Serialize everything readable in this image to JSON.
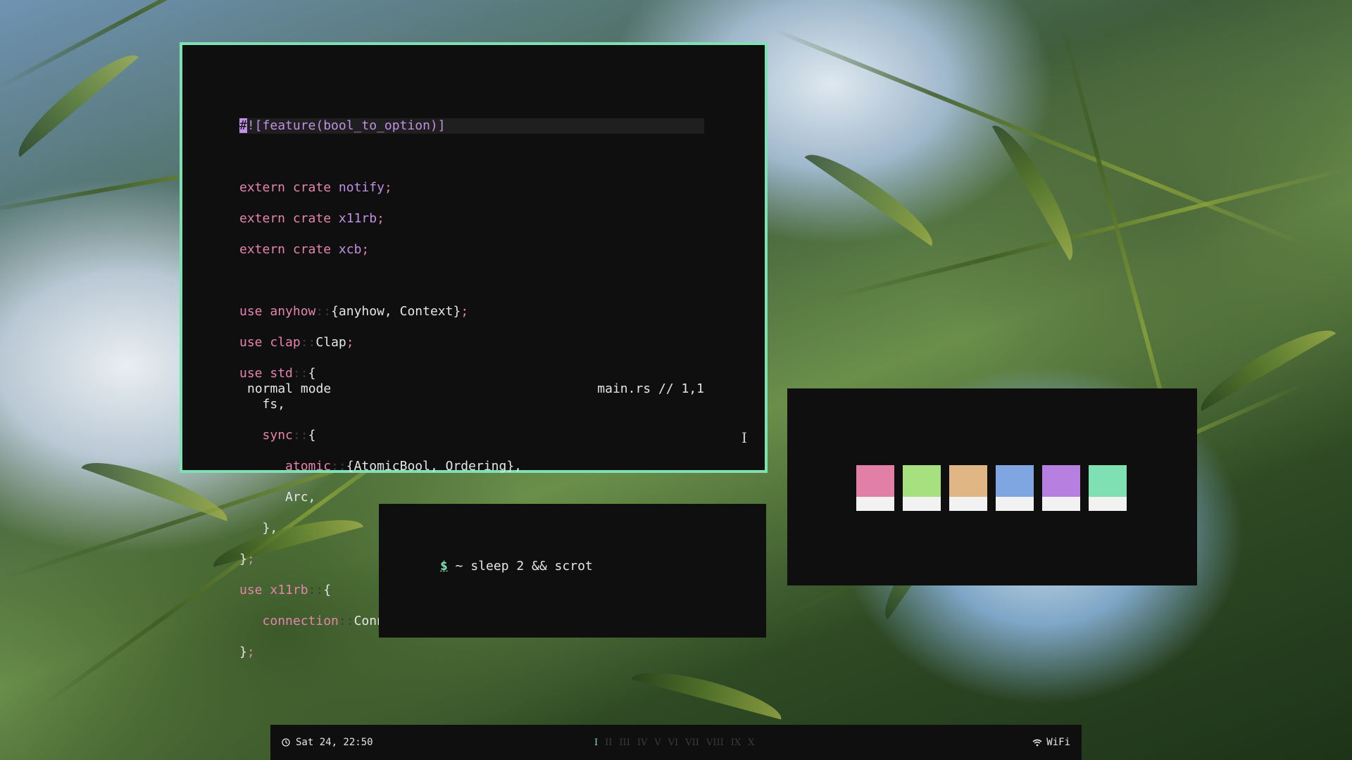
{
  "colors": {
    "accent": "#7fe0b4",
    "pink": "#e584ac",
    "purple": "#c290e6",
    "background": "#0f0f0f",
    "foreground": "#e6e6e6"
  },
  "editor": {
    "status_mode": "normal mode",
    "status_file": "main.rs // 1,1",
    "cursor_icon": "text-cursor-icon"
  },
  "terminal": {
    "prompt_symbol": "$",
    "command": " ~ sleep 2 && scrot"
  },
  "palette": {
    "swatches": [
      "#e17fa6",
      "#a6e07f",
      "#e0b784",
      "#7fa6e0",
      "#b77fe0",
      "#7fe0b4"
    ]
  },
  "bar": {
    "clock_icon": "clock-icon",
    "datetime": "Sat 24, 22:50",
    "workspaces": [
      "I",
      "II",
      "III",
      "IV",
      "V",
      "VI",
      "VII",
      "VIII",
      "IX",
      "X"
    ],
    "active_workspace": "I",
    "network_icon": "wifi-icon",
    "network_label": "WiFi"
  }
}
